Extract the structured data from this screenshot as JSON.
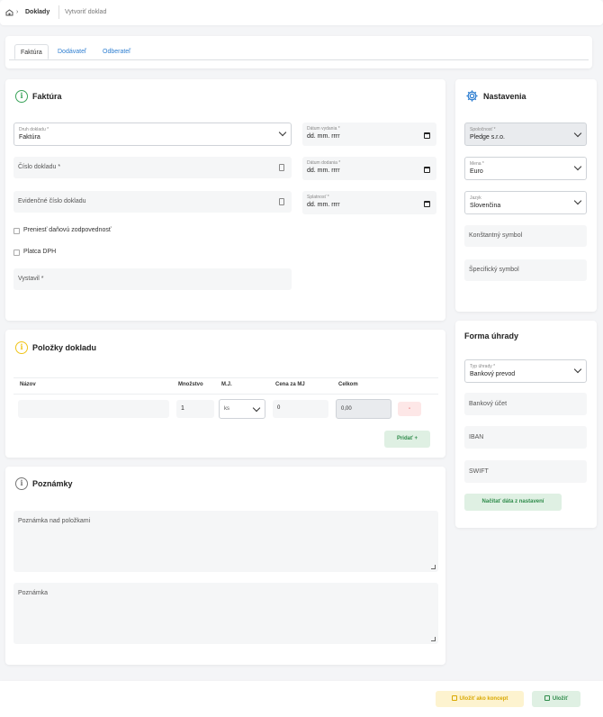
{
  "breadcrumb": {
    "section": "Doklady",
    "current": "Vytvoriť doklad"
  },
  "tabs": [
    "Faktúra",
    "Dodávateľ",
    "Odberateľ"
  ],
  "faktura": {
    "title": "Faktúra",
    "druh_label": "Druh dokladu *",
    "druh_value": "Faktúra",
    "cislo_placeholder": "Číslo dokladu *",
    "evidencne_placeholder": "Evidenčné číslo dokladu",
    "prenies_label": "Preniesť daňovú zodpovednosť",
    "platca_label": "Platca DPH",
    "vystavil_placeholder": "Vystavil *",
    "datum_vydania_label": "Dátum vydania *",
    "datum_dodania_label": "Dátum dodania *",
    "splatnost_label": "Splatnosť *",
    "date_placeholder": "dd. mm. rrrr"
  },
  "nastavenia": {
    "title": "Nastavenia",
    "spolocnost_label": "Spoločnosť *",
    "spolocnost_value": "Pledge s.r.o.",
    "mena_label": "Mena *",
    "mena_value": "Euro",
    "jazyk_label": "Jazyk",
    "jazyk_value": "Slovenčina",
    "konstantny_placeholder": "Konštantný symbol",
    "specificky_placeholder": "Špecifický symbol"
  },
  "polozky": {
    "title": "Položky dokladu",
    "headers": [
      "Názov",
      "Množstvo",
      "M.J.",
      "Cena za MJ",
      "Celkom"
    ],
    "row": {
      "mnozstvo": "1",
      "mj": "ks",
      "cena": "0",
      "celkom": "0,00",
      "remove": "-"
    },
    "add_label": "Pridať +"
  },
  "poznamky": {
    "title": "Poznámky",
    "nad_placeholder": "Poznámka nad položkami",
    "poznamka_placeholder": "Poznámka"
  },
  "forma": {
    "title": "Forma úhrady",
    "typ_label": "Typ úhrady *",
    "typ_value": "Bankový prevod",
    "ucet_placeholder": "Bankový účet",
    "iban_placeholder": "IBAN",
    "swift_placeholder": "SWIFT",
    "nacitat_label": "Načítať dáta z nastavení"
  },
  "footer": {
    "koncept_label": "Uložiť ako koncept",
    "ulozit_label": "Uložiť"
  },
  "colors": {
    "green": "#3aa35a",
    "yellow": "#f0c419",
    "link": "#2f7fd1"
  }
}
